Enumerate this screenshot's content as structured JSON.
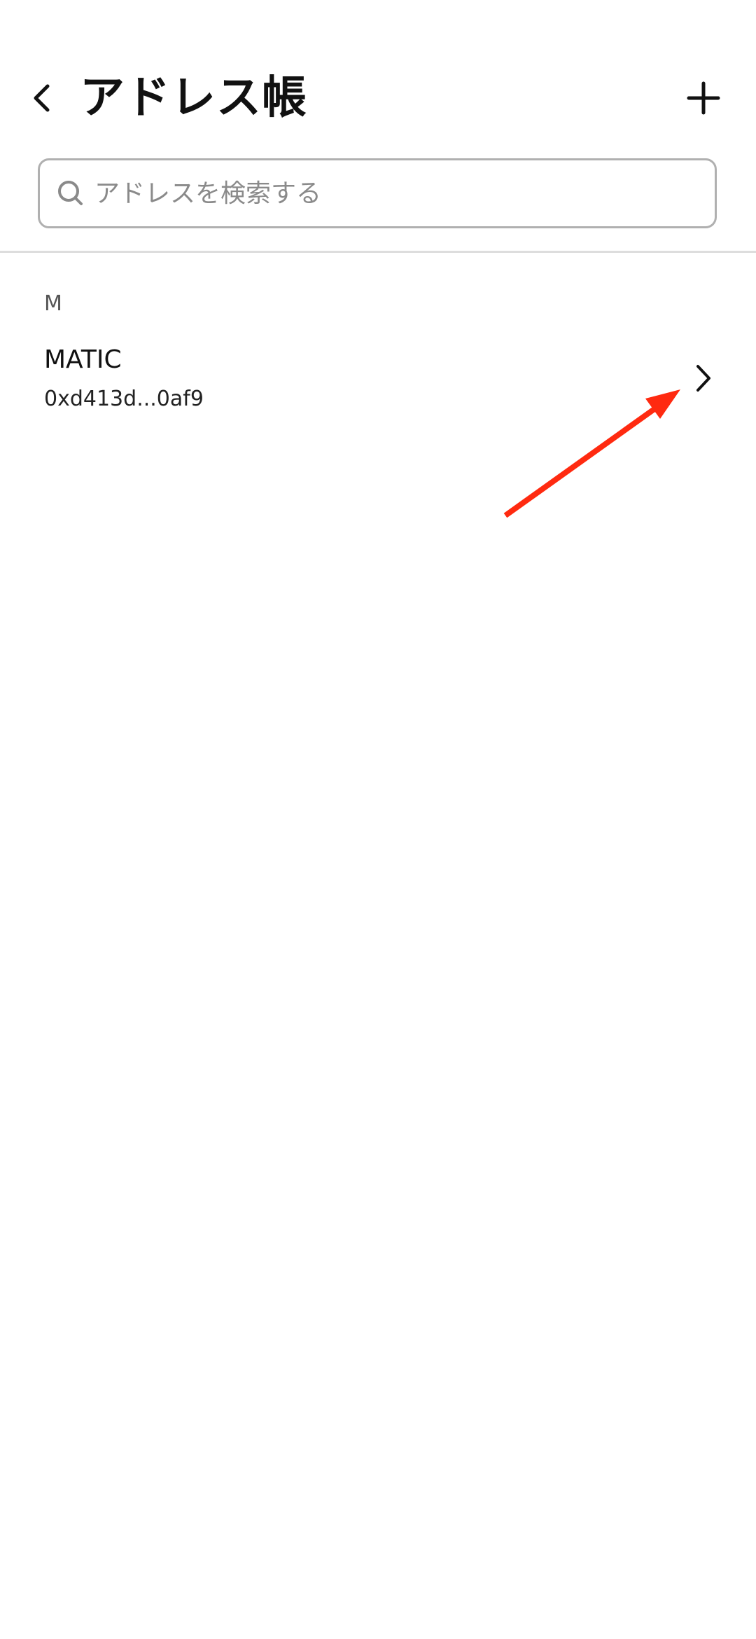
{
  "header": {
    "title": "アドレス帳",
    "back_icon": "chevron-left-icon",
    "add_icon": "plus-icon"
  },
  "search": {
    "placeholder": "アドレスを検索する",
    "value": "",
    "icon": "search-icon"
  },
  "address_list": {
    "sections": [
      {
        "letter": "M",
        "items": [
          {
            "name": "MATIC",
            "address": "0xd413d...0af9",
            "icon": "chevron-right-icon"
          }
        ]
      }
    ]
  },
  "annotation": {
    "icon": "arrow-annotation",
    "color": "#ff2a10"
  },
  "colors": {
    "background": "#ffffff",
    "text_primary": "#111111",
    "text_secondary": "#555555",
    "border": "#b0b0b0",
    "divider": "#dddddd"
  }
}
